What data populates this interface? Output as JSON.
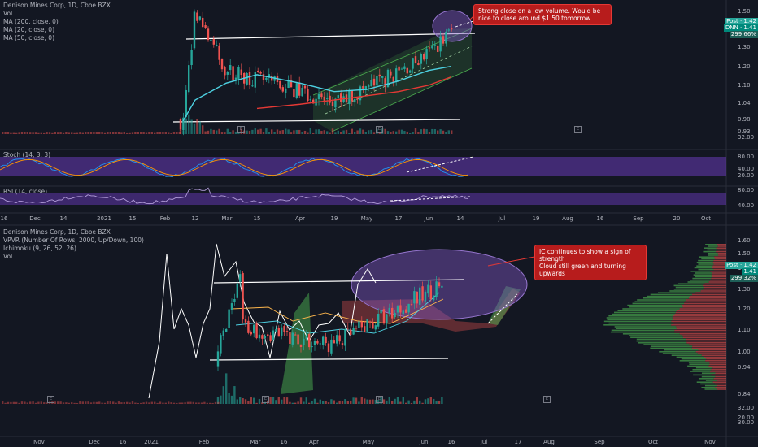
{
  "panel1": {
    "legend": [
      "Denison Mines Corp, 1D, Cboe BZX",
      "Vol",
      "MA (200, close, 0)",
      "MA (20, close, 0)",
      "MA (50, close, 0)"
    ],
    "stoch_label": "Stoch (14, 3, 3)",
    "rsi_label": "RSI (14, close)",
    "note": "Strong close on a low volume. Would be nice to close around $1.50 tomorrow",
    "price_axis": [
      "1.50",
      "1.40",
      "1.30",
      "1.20",
      "1.10",
      "1.04",
      "0.98",
      "0.93",
      "32.00"
    ],
    "stoch_axis": [
      "80.00",
      "40.00",
      "20.00"
    ],
    "rsi_axis": [
      "80.00",
      "40.00"
    ],
    "price_tags": [
      {
        "text": "Post · 1.42",
        "color": "#26a69a"
      },
      {
        "text": "DNN · 1.41",
        "color": "#00897b"
      },
      {
        "text": "299.66%",
        "color": "#1e5f57"
      }
    ],
    "time_axis": [
      "16",
      "Dec",
      "14",
      "2021",
      "15",
      "Feb",
      "12",
      "Mar",
      "15",
      "Apr",
      "19",
      "May",
      "17",
      "Jun",
      "14",
      "Jul",
      "19",
      "Aug",
      "16",
      "Sep",
      "20",
      "Oct"
    ],
    "badges": [
      "E",
      "E",
      "E"
    ]
  },
  "panel2": {
    "legend": [
      "Denison Mines Corp, 1D, Cboe BZX",
      "VPVR (Number Of Rows, 2000, Up/Down, 100)",
      "Ichimoku (9, 26, 52, 26)",
      "Vol"
    ],
    "note_lines": [
      "IC continues to show a sign of strength",
      "Cloud still green and turning upwards"
    ],
    "price_axis": [
      "1.60",
      "1.50",
      "1.40",
      "1.30",
      "1.20",
      "1.10",
      "1.00",
      "0.94",
      "0.84",
      "32.00",
      "20.00",
      "30.00"
    ],
    "price_tags": [
      {
        "text": "Post · 1.42",
        "color": "#26a69a"
      },
      {
        "text": "1.41",
        "color": "#00897b"
      },
      {
        "text": "299.32%",
        "color": "#1e5f57"
      }
    ],
    "time_axis": [
      "Nov",
      "Dec",
      "16",
      "2021",
      "Feb",
      "Mar",
      "16",
      "Apr",
      "May",
      "Jun",
      "16",
      "Jul",
      "17",
      "Aug",
      "Sep",
      "Oct",
      "Nov"
    ],
    "badges": [
      "E",
      "E",
      "E",
      "E"
    ]
  },
  "chart_data": [
    {
      "type": "line",
      "title": "Denison Mines Corp, 1D, Cboe BZX",
      "x": [
        "Feb",
        "Feb 12",
        "Mar",
        "Mar 15",
        "Apr",
        "Apr 19",
        "May",
        "May 17",
        "Jun",
        "Jun 14"
      ],
      "series": [
        {
          "name": "DNN close",
          "values": [
            0.98,
            1.5,
            1.22,
            1.18,
            1.12,
            1.06,
            1.14,
            1.21,
            1.3,
            1.41
          ]
        },
        {
          "name": "MA (20, close, 0)",
          "values": [
            0.98,
            1.08,
            1.16,
            1.2,
            1.16,
            1.12,
            1.13,
            1.17,
            1.22,
            1.24
          ]
        },
        {
          "name": "MA (50, close, 0)",
          "values": [
            null,
            null,
            null,
            1.04,
            1.06,
            1.08,
            1.1,
            1.12,
            1.15,
            1.19
          ]
        }
      ],
      "ylim": [
        0.93,
        1.55
      ]
    },
    {
      "type": "line",
      "title": "Stoch (14, 3, 3)",
      "x": [
        "Dec",
        "2021",
        "Feb",
        "Mar",
        "Apr",
        "May",
        "Jun"
      ],
      "series": [
        {
          "name": "%K",
          "values": [
            45,
            70,
            85,
            30,
            75,
            25,
            85
          ]
        }
      ],
      "ylim": [
        0,
        100
      ]
    },
    {
      "type": "line",
      "title": "RSI (14, close)",
      "x": [
        "Dec",
        "2021",
        "Feb",
        "Mar",
        "Apr",
        "May",
        "Jun"
      ],
      "series": [
        {
          "name": "RSI",
          "values": [
            55,
            60,
            75,
            52,
            50,
            45,
            62
          ]
        }
      ],
      "ylim": [
        30,
        90
      ]
    }
  ]
}
